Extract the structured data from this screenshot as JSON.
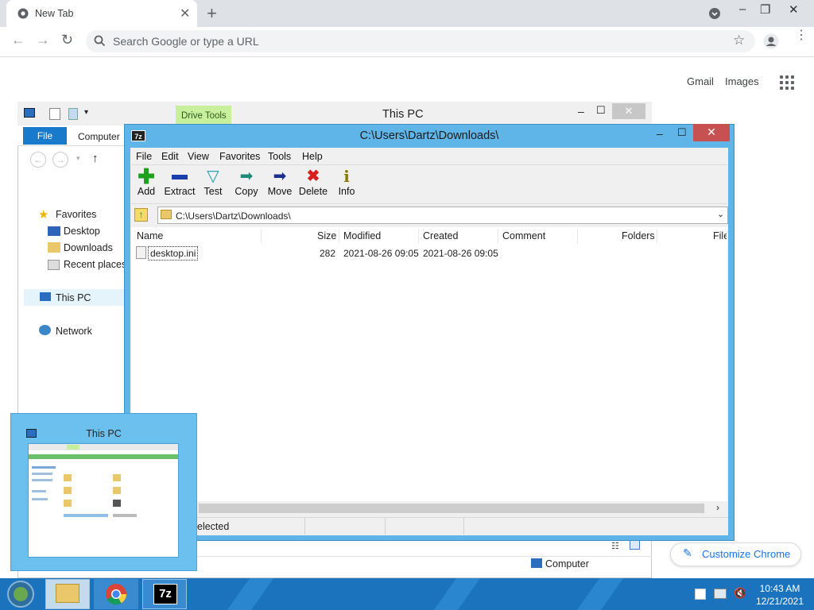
{
  "chrome": {
    "tab_title": "New Tab",
    "omnibox_placeholder": "Search Google or type a URL",
    "gmail": "Gmail",
    "images": "Images",
    "customize": "Customize Chrome"
  },
  "explorer": {
    "title": "This PC",
    "drive_tools": "Drive Tools",
    "file_tab": "File",
    "computer_tab": "Computer",
    "nav": {
      "favorites": "Favorites",
      "desktop": "Desktop",
      "downloads": "Downloads",
      "recent": "Recent places",
      "this_pc": "This PC",
      "network": "Network"
    },
    "status_computer": "Computer"
  },
  "zip": {
    "title": "C:\\Users\\Dartz\\Downloads\\",
    "menu": [
      "File",
      "Edit",
      "View",
      "Favorites",
      "Tools",
      "Help"
    ],
    "toolbar": [
      "Add",
      "Extract",
      "Test",
      "Copy",
      "Move",
      "Delete",
      "Info"
    ],
    "address": "C:\\Users\\Dartz\\Downloads\\",
    "columns": [
      "Name",
      "Size",
      "Modified",
      "Created",
      "Comment",
      "Folders",
      "File"
    ],
    "rows": [
      {
        "name": "desktop.ini",
        "size": "282",
        "modified": "2021-08-26 09:05",
        "created": "2021-08-26 09:05"
      }
    ],
    "status": "elected"
  },
  "thumbnail": {
    "title": "This PC"
  },
  "taskbar": {
    "time": "10:43 AM",
    "date": "12/21/2021",
    "zip_label": "7z"
  }
}
